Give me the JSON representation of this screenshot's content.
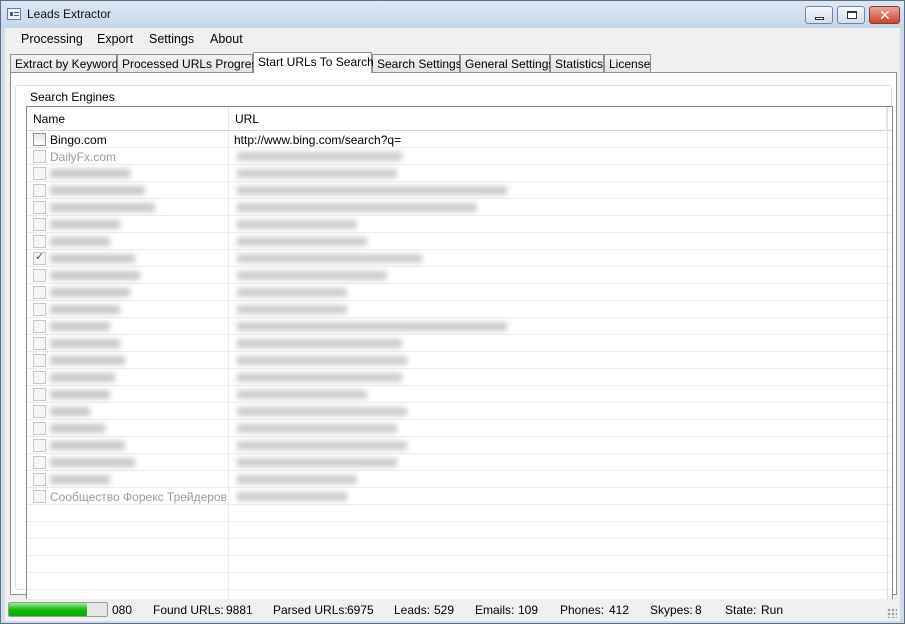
{
  "window": {
    "title": "Leads Extractor"
  },
  "menu": [
    "Processing",
    "Export",
    "Settings",
    "About"
  ],
  "tabs": [
    {
      "label": "Extract by Keywords"
    },
    {
      "label": "Processed URLs Progress"
    },
    {
      "label": "Start URLs To Search",
      "active": true
    },
    {
      "label": "Search Settings"
    },
    {
      "label": "General Settings"
    },
    {
      "label": "Statistics"
    },
    {
      "label": "License"
    }
  ],
  "group": {
    "title": "Search Engines"
  },
  "grid": {
    "columns": [
      "Name",
      "URL"
    ],
    "rows": [
      {
        "name": "Bingo.com",
        "url": "http://www.bing.com/search?q=",
        "checked": false
      },
      {
        "name": "DailyFx.com",
        "url": "",
        "checked": false
      },
      {
        "name": "",
        "url": "",
        "checked": false
      },
      {
        "name": "",
        "url": "",
        "checked": false
      },
      {
        "name": "",
        "url": "",
        "checked": false
      },
      {
        "name": "",
        "url": "",
        "checked": false
      },
      {
        "name": "",
        "url": "",
        "checked": false
      },
      {
        "name": "",
        "url": "",
        "checked": true
      },
      {
        "name": "",
        "url": "",
        "checked": false
      },
      {
        "name": "",
        "url": "",
        "checked": false
      },
      {
        "name": "",
        "url": "",
        "checked": false
      },
      {
        "name": "",
        "url": "",
        "checked": false
      },
      {
        "name": "",
        "url": "",
        "checked": false
      },
      {
        "name": "",
        "url": "",
        "checked": false
      },
      {
        "name": "",
        "url": "",
        "checked": false
      },
      {
        "name": "",
        "url": "",
        "checked": false
      },
      {
        "name": "",
        "url": "",
        "checked": false
      },
      {
        "name": "",
        "url": "",
        "checked": false
      },
      {
        "name": "",
        "url": "",
        "checked": false
      },
      {
        "name": "",
        "url": "",
        "checked": false
      },
      {
        "name": "",
        "url": "",
        "checked": false
      },
      {
        "name": "Сообщество Форекс Трейдеров",
        "url": "",
        "checked": false
      }
    ]
  },
  "status": {
    "progress_value": 0.8,
    "progress_label": "080",
    "found_urls_label": "Found URLs:",
    "found_urls": "9881",
    "parsed_urls_label": "Parsed URLs:",
    "parsed_urls": "6975",
    "leads_label": "Leads:",
    "leads": "529",
    "emails_label": "Emails:",
    "emails": "109",
    "phones_label": "Phones:",
    "phones": "412",
    "skypes_label": "Skypes:",
    "skypes": "8",
    "state_label": "State:",
    "state": "Run"
  },
  "colors": {
    "progress": "#16b811",
    "title_bar": "#c6d6ea"
  }
}
